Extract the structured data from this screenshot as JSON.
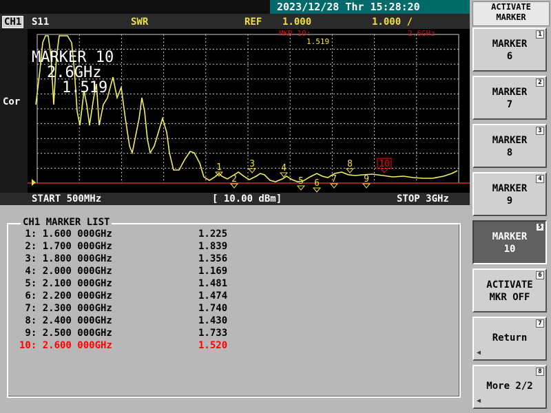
{
  "datetime": "2023/12/28 Thr 15:28:20",
  "header": {
    "channel": "CH1",
    "param": "S11",
    "format": "SWR",
    "ref_label": "REF",
    "ref_value": "1.000",
    "scale": "1.000 /"
  },
  "left_label": "Cor",
  "marker_readout": {
    "title": "MARKER 10",
    "freq": "2.6GHz",
    "value": "1.519",
    "small_label": "MKR 10:",
    "small_value": "1.519",
    "small_freq": "2.6GHz"
  },
  "footer": {
    "start": "START 500MHz",
    "power": "[ 10.00 dBm]",
    "stop": "STOP 3GHz"
  },
  "marker_list": {
    "title": "CH1 MARKER LIST",
    "rows": [
      {
        "label": " 1: 1.600 000GHz",
        "value": "1.225"
      },
      {
        "label": " 2: 1.700 000GHz",
        "value": "1.839"
      },
      {
        "label": " 3: 1.800 000GHz",
        "value": "1.356"
      },
      {
        "label": " 4: 2.000 000GHz",
        "value": "1.169"
      },
      {
        "label": " 5: 2.100 000GHz",
        "value": "1.481"
      },
      {
        "label": " 6: 2.200 000GHz",
        "value": "1.474"
      },
      {
        "label": " 7: 2.300 000GHz",
        "value": "1.740"
      },
      {
        "label": " 8: 2.400 000GHz",
        "value": "1.430"
      },
      {
        "label": " 9: 2.500 000GHz",
        "value": "1.733"
      },
      {
        "label": "10: 2.600 000GHz",
        "value": "1.520"
      }
    ]
  },
  "softkeys": {
    "title_line1": "ACTIVATE",
    "title_line2": "MARKER",
    "keys": [
      {
        "line1": "MARKER",
        "line2": "6",
        "num": "1"
      },
      {
        "line1": "MARKER",
        "line2": "7",
        "num": "2"
      },
      {
        "line1": "MARKER",
        "line2": "8",
        "num": "3"
      },
      {
        "line1": "MARKER",
        "line2": "9",
        "num": "4"
      },
      {
        "line1": "MARKER",
        "line2": "10",
        "num": "5"
      },
      {
        "line1": "ACTIVATE",
        "line2": "MKR OFF",
        "num": "6"
      },
      {
        "line1": "Return",
        "line2": "",
        "num": "7"
      },
      {
        "line1": "More 2/2",
        "line2": "",
        "num": "8"
      }
    ]
  },
  "marker_flags": [
    "1",
    "2",
    "3",
    "4",
    "5",
    "6",
    "7",
    "8",
    "9",
    "10"
  ],
  "colors": {
    "trace": "#f0f060",
    "grid": "#cfcfcf",
    "active": "#ff0000",
    "marker": "#f0e040"
  }
}
